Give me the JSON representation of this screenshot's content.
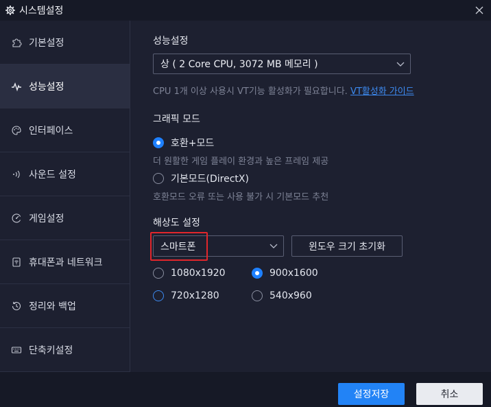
{
  "window": {
    "title": "시스템설정"
  },
  "sidebar": {
    "items": [
      {
        "label": "기본설정",
        "icon": "puzzle-icon"
      },
      {
        "label": "성능설정",
        "icon": "pulse-icon"
      },
      {
        "label": "인터페이스",
        "icon": "palette-icon"
      },
      {
        "label": "사운드 설정",
        "icon": "sound-icon"
      },
      {
        "label": "게임설정",
        "icon": "gauge-icon"
      },
      {
        "label": "휴대폰과 네트워크",
        "icon": "phone-wifi-icon"
      },
      {
        "label": "정리와 백업",
        "icon": "history-icon"
      },
      {
        "label": "단축키설정",
        "icon": "keyboard-icon"
      }
    ],
    "active_index": 1
  },
  "performance": {
    "heading": "성능설정",
    "select_value": "상 ( 2 Core CPU, 3072 MB 메모리 )",
    "hint_text": "CPU 1개 이상 사용시 VT기능 활성화가 필요합니다.",
    "hint_link": "VT활성화 가이드"
  },
  "graphics": {
    "heading": "그래픽 모드",
    "options": [
      {
        "label": "호환+모드",
        "desc": "더 원활한 게임 플레이 환경과 높은 프레임 제공",
        "checked": true
      },
      {
        "label": "기본모드(DirectX)",
        "desc": "호환모드 오류 또는 사용 불가 시 기본모드 추천",
        "checked": false
      }
    ]
  },
  "resolution": {
    "heading": "해상도 설정",
    "select_value": "스마트폰",
    "reset_button": "윈도우 크기 초기화",
    "options": [
      {
        "label": "1080x1920",
        "checked": false
      },
      {
        "label": "900x1600",
        "checked": true
      },
      {
        "label": "720x1280",
        "checked": false
      },
      {
        "label": "540x960",
        "checked": false
      }
    ]
  },
  "footer": {
    "save_label": "설정저장",
    "cancel_label": "취소"
  },
  "colors": {
    "accent": "#2283f6",
    "highlight": "#e3262b"
  }
}
